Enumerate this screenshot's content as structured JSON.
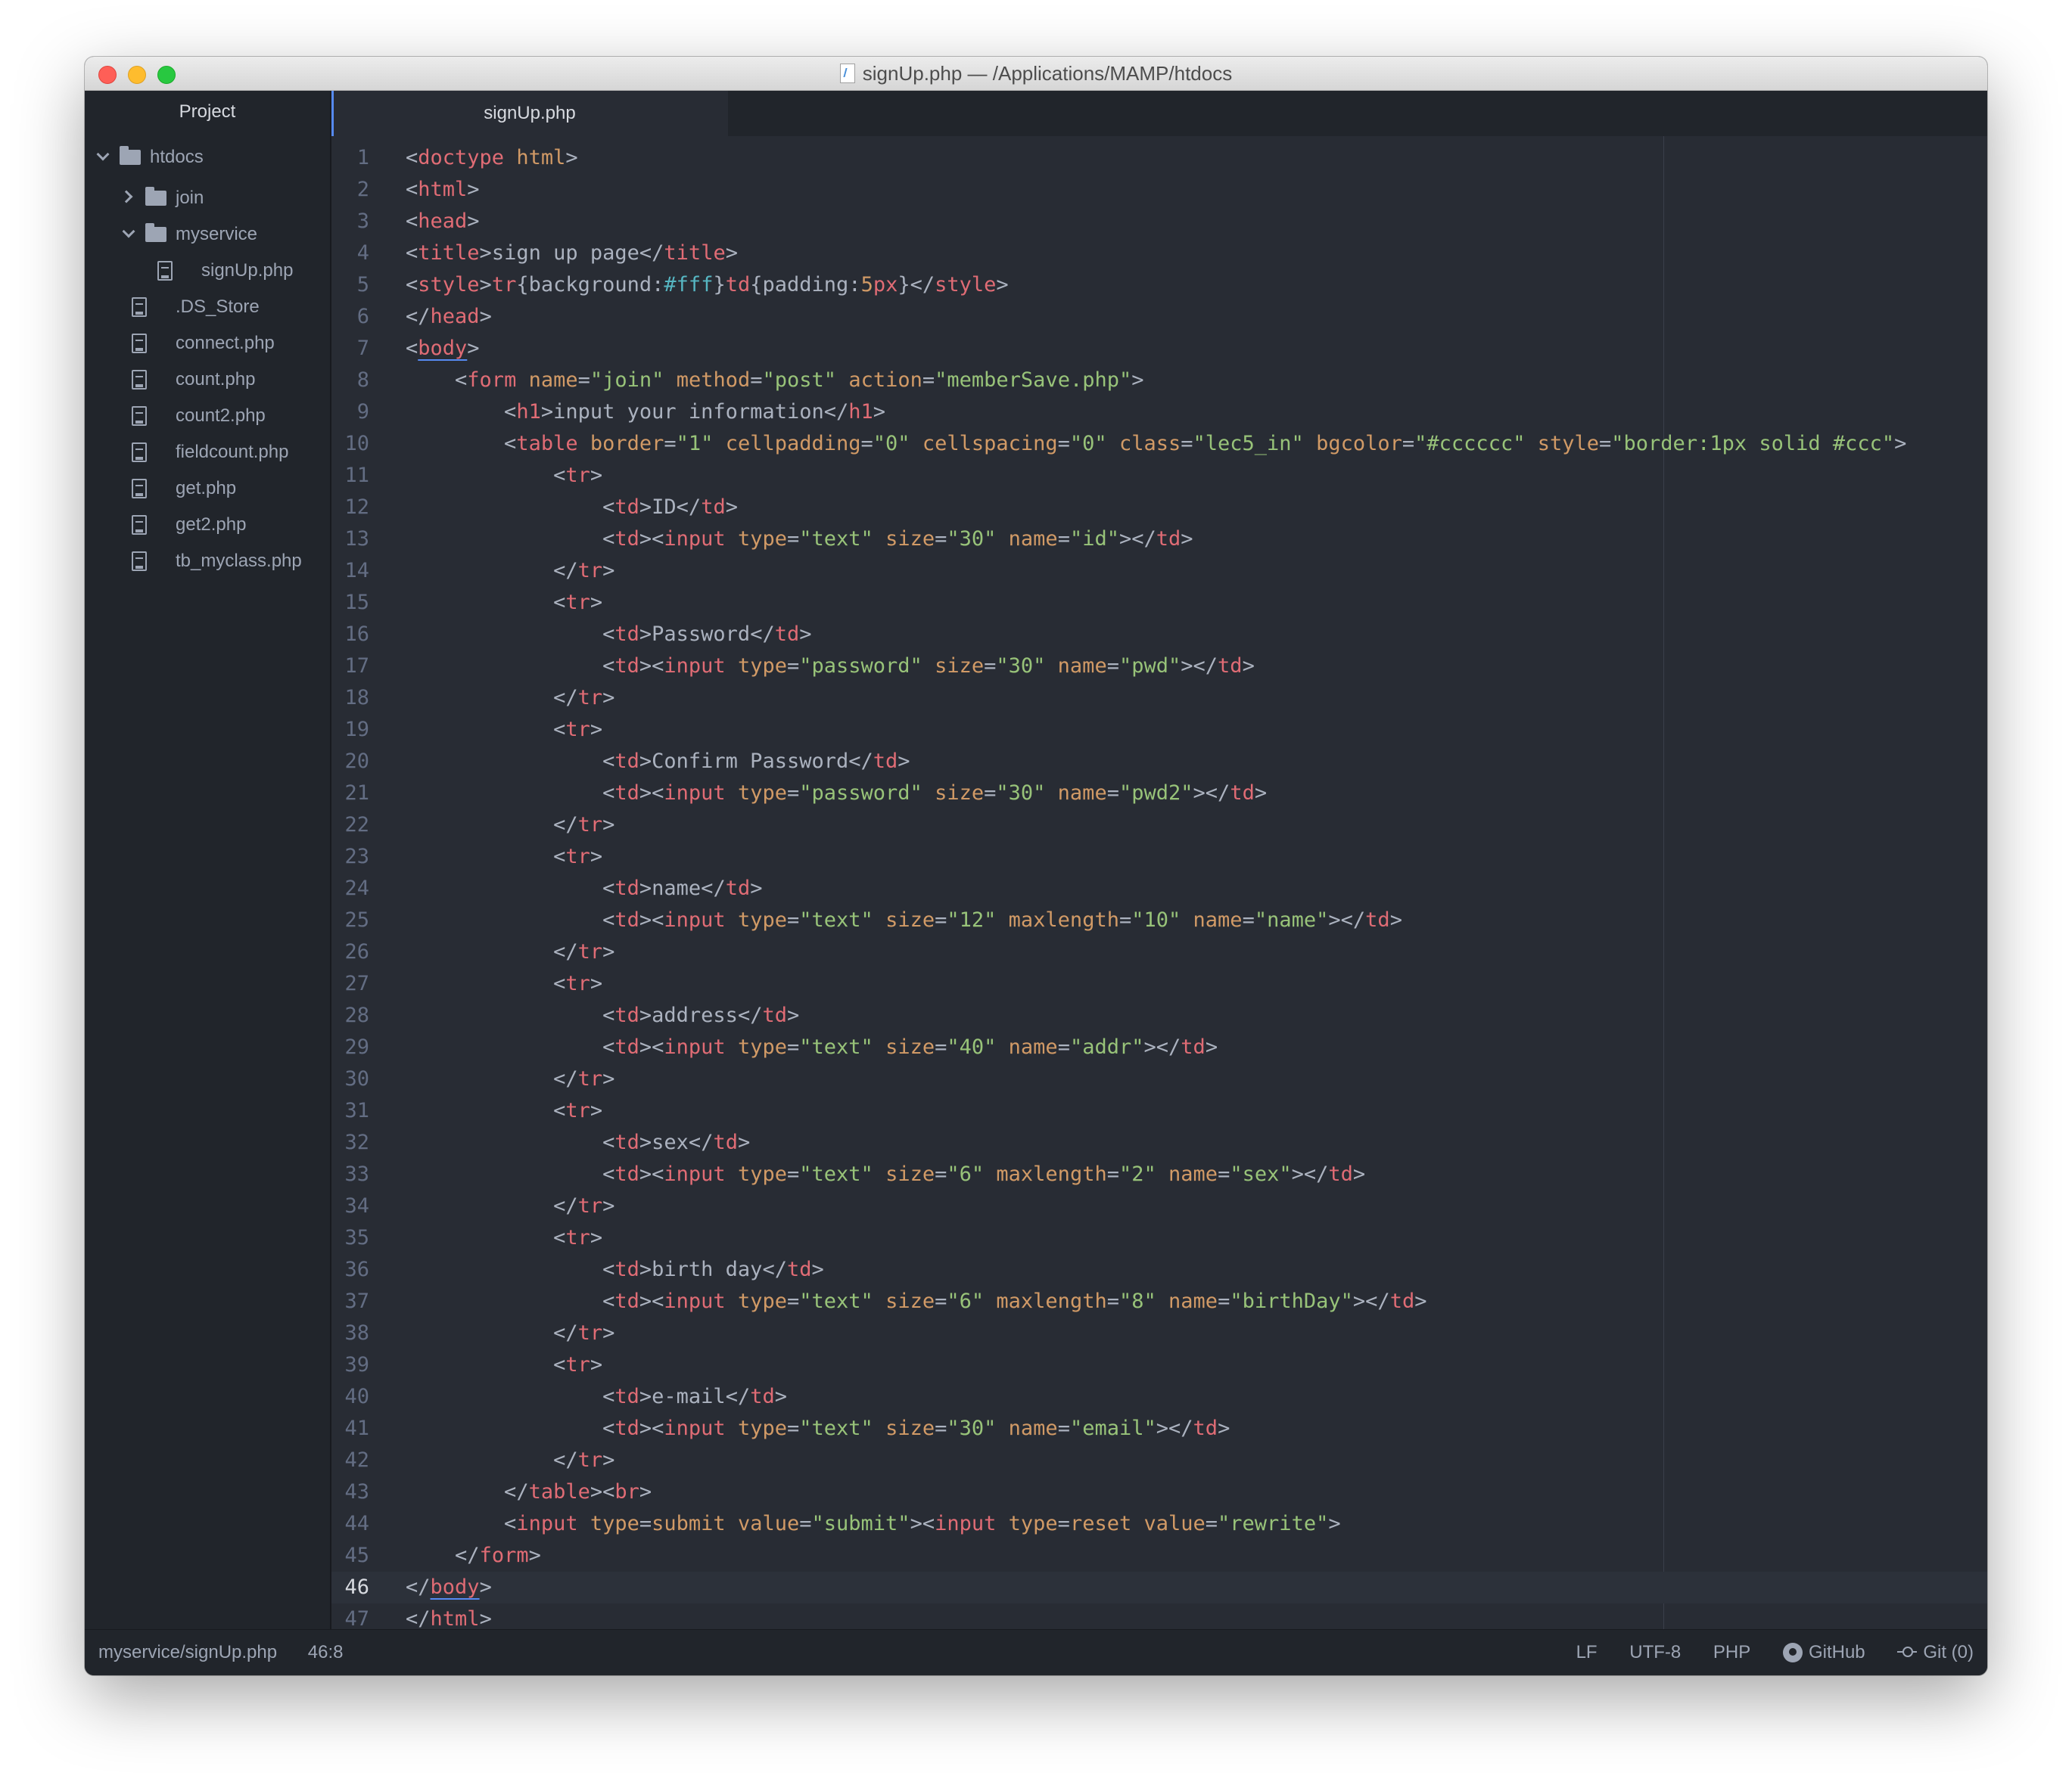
{
  "window": {
    "title": "signUp.php — /Applications/MAMP/htdocs"
  },
  "sidebar": {
    "header": "Project",
    "tree": [
      {
        "label": "htdocs",
        "type": "folder",
        "expanded": true,
        "depth": 0
      },
      {
        "label": "join",
        "type": "folder",
        "expanded": false,
        "depth": 1
      },
      {
        "label": "myservice",
        "type": "folder",
        "expanded": true,
        "depth": 1
      },
      {
        "label": "signUp.php",
        "type": "file",
        "depth": 2
      },
      {
        "label": ".DS_Store",
        "type": "file",
        "depth": 1
      },
      {
        "label": "connect.php",
        "type": "file",
        "depth": 1
      },
      {
        "label": "count.php",
        "type": "file",
        "depth": 1
      },
      {
        "label": "count2.php",
        "type": "file",
        "depth": 1
      },
      {
        "label": "fieldcount.php",
        "type": "file",
        "depth": 1
      },
      {
        "label": "get.php",
        "type": "file",
        "depth": 1
      },
      {
        "label": "get2.php",
        "type": "file",
        "depth": 1
      },
      {
        "label": "tb_myclass.php",
        "type": "file",
        "depth": 1
      }
    ]
  },
  "tabs": [
    {
      "label": "signUp.php",
      "active": true
    }
  ],
  "editor": {
    "cursor_line": 46,
    "lines": [
      "<doctype html>",
      "<html>",
      "<head>",
      "<title>sign up page</title>",
      "<style>tr{background:#fff}td{padding:5px}</style>",
      "</head>",
      "<body>",
      "    <form name=\"join\" method=\"post\" action=\"memberSave.php\">",
      "        <h1>input your information</h1>",
      "        <table border=\"1\" cellpadding=\"0\" cellspacing=\"0\" class=\"lec5_in\" bgcolor=\"#cccccc\" style=\"border:1px solid #ccc\">",
      "            <tr>",
      "                <td>ID</td>",
      "                <td><input type=\"text\" size=\"30\" name=\"id\"></td>",
      "            </tr>",
      "            <tr>",
      "                <td>Password</td>",
      "                <td><input type=\"password\" size=\"30\" name=\"pwd\"></td>",
      "            </tr>",
      "            <tr>",
      "                <td>Confirm Password</td>",
      "                <td><input type=\"password\" size=\"30\" name=\"pwd2\"></td>",
      "            </tr>",
      "            <tr>",
      "                <td>name</td>",
      "                <td><input type=\"text\" size=\"12\" maxlength=\"10\" name=\"name\"></td>",
      "            </tr>",
      "            <tr>",
      "                <td>address</td>",
      "                <td><input type=\"text\" size=\"40\" name=\"addr\"></td>",
      "            </tr>",
      "            <tr>",
      "                <td>sex</td>",
      "                <td><input type=\"text\" size=\"6\" maxlength=\"2\" name=\"sex\"></td>",
      "            </tr>",
      "            <tr>",
      "                <td>birth day</td>",
      "                <td><input type=\"text\" size=\"6\" maxlength=\"8\" name=\"birthDay\"></td>",
      "            </tr>",
      "            <tr>",
      "                <td>e-mail</td>",
      "                <td><input type=\"text\" size=\"30\" name=\"email\"></td>",
      "            </tr>",
      "        </table><br>",
      "        <input type=submit value=\"submit\"><input type=reset value=\"rewrite\">",
      "    </form>",
      "</body>",
      "</html>"
    ]
  },
  "statusbar": {
    "file_path": "myservice/signUp.php",
    "cursor_position": "46:8",
    "line_ending": "LF",
    "encoding": "UTF-8",
    "grammar": "PHP",
    "github": "GitHub",
    "git": "Git (0)"
  }
}
